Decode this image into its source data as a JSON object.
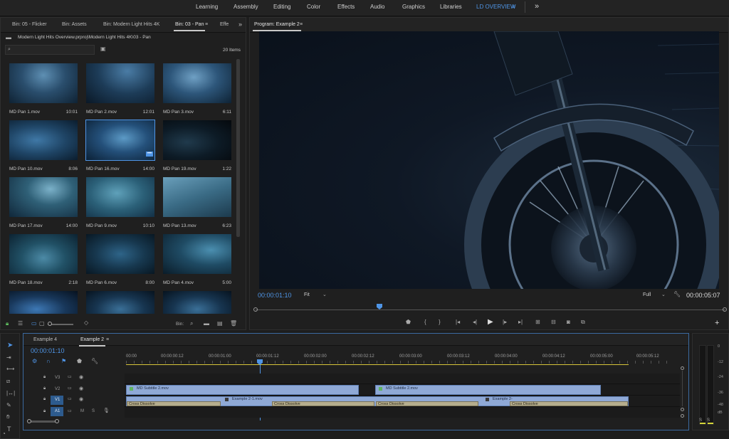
{
  "workspaces": {
    "items": [
      "Learning",
      "Assembly",
      "Editing",
      "Color",
      "Effects",
      "Audio",
      "Graphics",
      "Libraries",
      "LD OVERVIEW"
    ],
    "active": "LD OVERVIEW",
    "menu_glyph": "≡",
    "overflow_glyph": "»"
  },
  "project": {
    "tabs": [
      "Bin: 05 - Flicker",
      "Bin: Assets",
      "Bin: Modern Light Hits 4K",
      "Bin: 03 - Pan",
      "Effe"
    ],
    "active_tab": "Bin: 03 - Pan",
    "path": "Modern Light Hits Overview.prproj\\Modern Light Hits 4K\\03 - Pan",
    "item_count": "20 Items",
    "items": [
      {
        "name": "MD Pan 1.mov",
        "duration": "10:01"
      },
      {
        "name": "MD Pan 2.mov",
        "duration": "12:01"
      },
      {
        "name": "MD Pan 3.mov",
        "duration": "6:11"
      },
      {
        "name": "MD Pan 10.mov",
        "duration": "8:06"
      },
      {
        "name": "MD Pan 16.mov",
        "duration": "14:00"
      },
      {
        "name": "MD Pan 19.mov",
        "duration": "1:22"
      },
      {
        "name": "MD Pan 17.mov",
        "duration": "14:00"
      },
      {
        "name": "MD Pan 9.mov",
        "duration": "10:10"
      },
      {
        "name": "MD Pan 13.mov",
        "duration": "6:23"
      },
      {
        "name": "MD Pan 18.mov",
        "duration": "2:18"
      },
      {
        "name": "MD Pan 6.mov",
        "duration": "8:00"
      },
      {
        "name": "MD Pan 4.mov",
        "duration": "5:00"
      }
    ],
    "bin_label": "Bin:"
  },
  "program": {
    "title": "Program: Example 2",
    "timecode": "00:00:01:10",
    "fit": "Fit",
    "resolution": "Full",
    "duration": "00:00:05:07"
  },
  "timeline": {
    "tabs": [
      "Example 4",
      "Example 2"
    ],
    "active_tab": "Example 2",
    "timecode": "00:00:01:10",
    "ruler": [
      "00:00",
      "00:00:00:12",
      "00:00:01:00",
      "00:00:01:12",
      "00:00:02:00",
      "00:00:02:12",
      "00:00:03:00",
      "00:00:03:12",
      "00:00:04:00",
      "00:00:04:12",
      "00:00:05:00",
      "00:00:05:12"
    ],
    "tracks": {
      "v3": "V3",
      "v2": "V2",
      "v1": "V1",
      "a1": "A1",
      "m": "M",
      "s": "S"
    },
    "clips": {
      "v2_a": "MD Subtitle 2.mov",
      "v2_b": "MD Subtitle 2.mov",
      "v1_a": "Example 2-1.mov",
      "v1_b": "Example 2-"
    },
    "transitions": [
      "Cross Dissolve",
      "Cross Dissolve",
      "Cross Dissolve",
      "Cross Dissolve"
    ]
  },
  "meter": {
    "labels": [
      "0",
      "-12",
      "-24",
      "-36",
      "-48",
      "dB"
    ],
    "solo": [
      "S",
      "S"
    ]
  }
}
